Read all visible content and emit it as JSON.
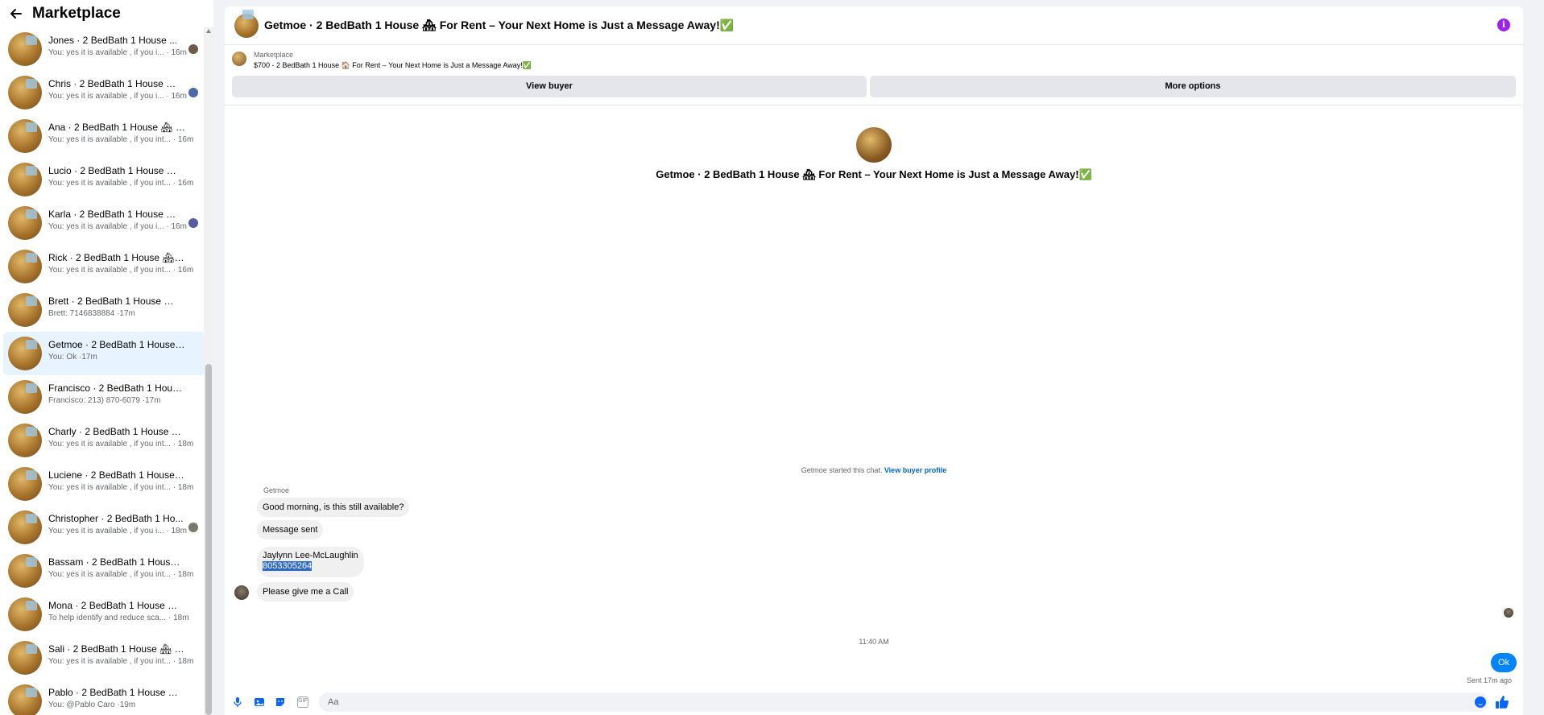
{
  "sidebar": {
    "title": "Marketplace",
    "conversations": [
      {
        "title": "Jones · 2 BedBath 1 House ...",
        "preview": "You: yes it is available , if you i...",
        "time": "16m"
      },
      {
        "title": "Chris · 2 BedBath 1 House 🏘 ...",
        "preview": "You: yes it is available , if you i...",
        "time": "16m"
      },
      {
        "title": "Ana · 2 BedBath 1 House 🏘 For...",
        "preview": "You: yes it is available , if you int...",
        "time": "16m"
      },
      {
        "title": "Lucio · 2 BedBath 1 House 🏘 F...",
        "preview": "You: yes it is available , if you int...",
        "time": "16m"
      },
      {
        "title": "Karla · 2 BedBath 1 House 🏘 ...",
        "preview": "You: yes it is available , if you i...",
        "time": "16m"
      },
      {
        "title": "Rick · 2 BedBath 1 House 🏘 For...",
        "preview": "You: yes it is available , if you int...",
        "time": "16m"
      },
      {
        "title": "Brett · 2 BedBath 1 House 🏘 Fo...",
        "preview": "Brett: 7146838884 ·",
        "time": "17m"
      },
      {
        "title": "Getmoe · 2 BedBath 1 House ...",
        "preview": "You: Ok ·",
        "time": "17m"
      },
      {
        "title": "Francisco · 2 BedBath 1 House ...",
        "preview": "Francisco: 213) 870-6079 ·",
        "time": "17m"
      },
      {
        "title": "Charly · 2 BedBath 1 House 🏘 F...",
        "preview": "You: yes it is available , if you int...",
        "time": "18m"
      },
      {
        "title": "Luciene · 2 BedBath 1 House 🏘...",
        "preview": "You: yes it is available , if you int...",
        "time": "18m"
      },
      {
        "title": "Christopher · 2 BedBath 1 Ho...",
        "preview": "You: yes it is available , if you i...",
        "time": "18m"
      },
      {
        "title": "Bassam · 2 BedBath 1 House 🏘...",
        "preview": "You: yes it is available , if you int...",
        "time": "18m"
      },
      {
        "title": "Mona · 2 BedBath 1 House 🏘 F...",
        "preview": "To help identify and reduce sca...",
        "time": "18m"
      },
      {
        "title": "Sali · 2 BedBath 1 House 🏘 For ...",
        "preview": "You: yes it is available , if you int...",
        "time": "18m"
      },
      {
        "title": "Pablo · 2 BedBath 1 House 🏘 F...",
        "preview": "You: @Pablo Caro ·",
        "time": "19m"
      }
    ]
  },
  "chat": {
    "header_title": "Getmoe · 2 BedBath 1 House 🏘 For Rent – Your Next Home is Just a Message Away!✅",
    "marketplace_label": "Marketplace",
    "listing_title": "$700 - 2 BedBath 1 House 🏠 For Rent – Your Next Home is Just a Message Away!✅",
    "view_buyer": "View buyer",
    "more_options": "More options",
    "center_name": "Getmoe · 2 BedBath 1 House 🏘 For Rent – Your Next Home is Just a Message Away!✅",
    "started_text": "Getmoe started this chat.",
    "view_buyer_profile": "View buyer profile",
    "sender": "Getmoe",
    "messages": {
      "m1": "Good morning, is this still available?",
      "m2": "Message sent",
      "m3_line1": "Jaylynn Lee-McLaughlin",
      "m3_line2": "8053305264",
      "m4": "Please give me a Call"
    },
    "time_divider": "11:40 AM",
    "my_message": "Ok",
    "sent_status": "Sent 17m ago",
    "input_placeholder": "Aa"
  },
  "colors": {
    "accent": "#0084ff",
    "active_row": "#e7f3ff",
    "info": "#a020f0"
  }
}
